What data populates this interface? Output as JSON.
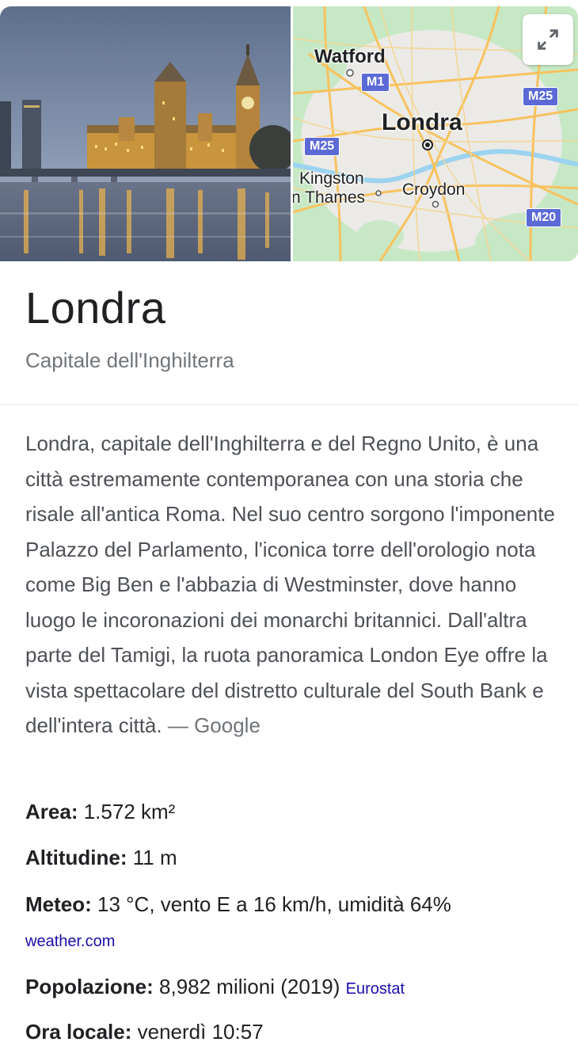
{
  "title": "Londra",
  "subtitle": "Capitale dell'Inghilterra",
  "map": {
    "labels": {
      "watford": "Watford",
      "london": "Londra",
      "kingston": "Kingston",
      "thames": "n Thames",
      "croydon": "Croydon"
    },
    "shields": {
      "m1": "M1",
      "m25_top": "M25",
      "m25_left": "M25",
      "m20": "M20"
    }
  },
  "description": {
    "text": "Londra, capitale dell'Inghilterra e del Regno Unito, è una città estremamente contemporanea con una storia che risale all'antica Roma. Nel suo centro sorgono l'imponente Palazzo del Parlamento, l'iconica torre dell'orologio nota come Big Ben e l'abbazia di Westminster, dove hanno luogo le incoronazioni dei monarchi britannici. Dall'altra parte del Tamigi, la ruota panoramica London Eye offre la vista spettacolare del distretto culturale del South Bank e dell'intera città.",
    "source": "— Google"
  },
  "facts": {
    "area": {
      "label": "Area:",
      "value": "1.572 km²"
    },
    "altitude": {
      "label": "Altitudine:",
      "value": "11 m"
    },
    "weather": {
      "label": "Meteo:",
      "value": "13 °C, vento E a 16 km/h, umidità 64%",
      "link": "weather.com"
    },
    "population": {
      "label": "Popolazione:",
      "value": "8,982 milioni (2019)",
      "link": "Eurostat"
    },
    "local_time": {
      "label": "Ora locale:",
      "value": "venerdì 10:57"
    }
  }
}
